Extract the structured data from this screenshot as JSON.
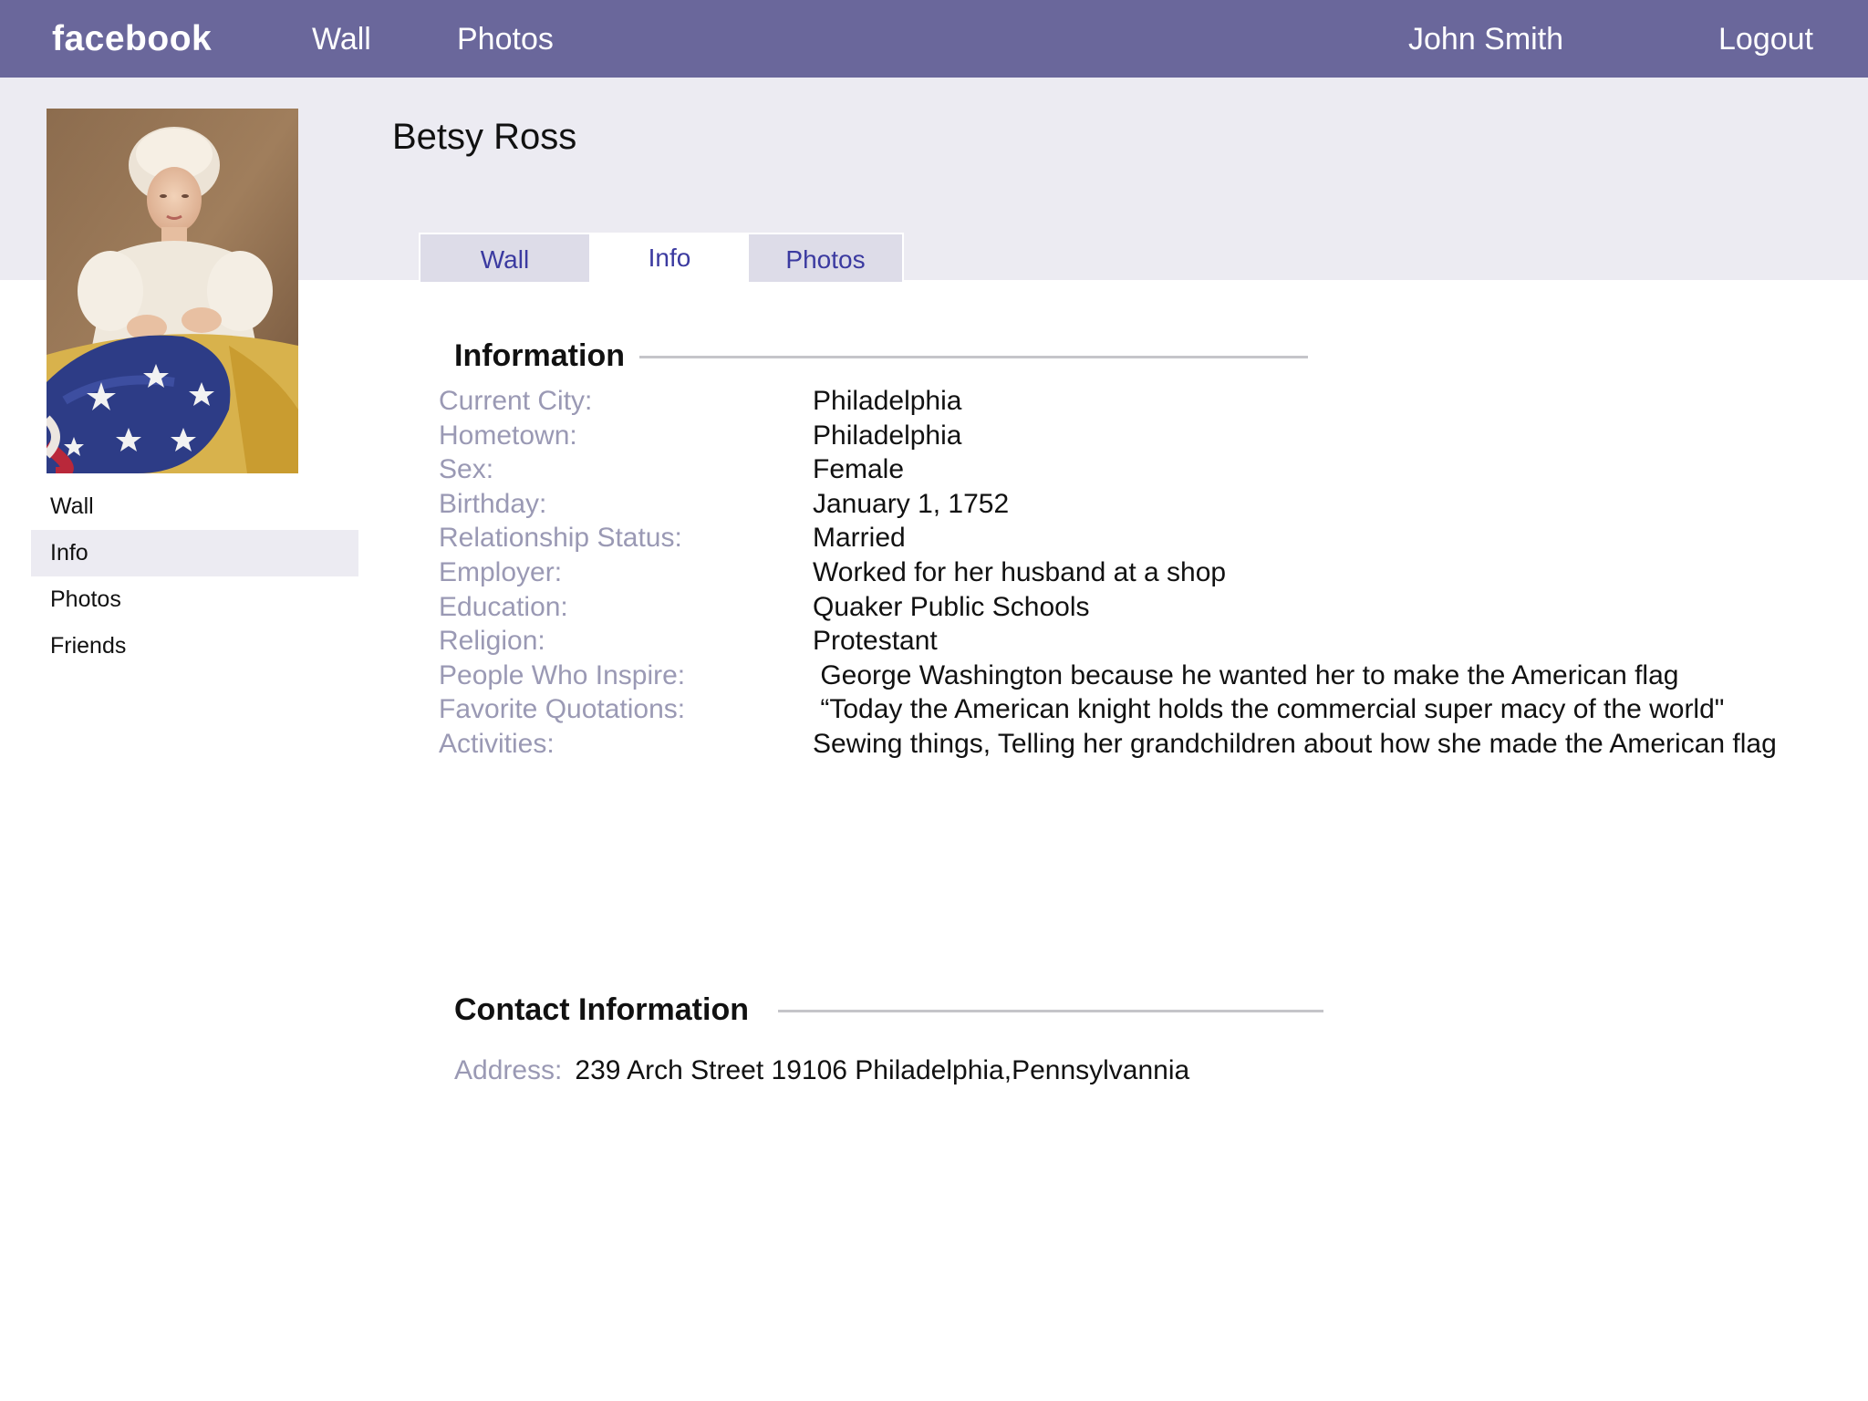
{
  "topbar": {
    "logo": "facebook",
    "nav_wall": "Wall",
    "nav_photos": "Photos",
    "user_name": "John Smith",
    "logout": "Logout"
  },
  "profile": {
    "name": "Betsy Ross",
    "photo_icon": "profile-photo"
  },
  "sidebar": {
    "items": [
      {
        "label": "Wall"
      },
      {
        "label": "Info"
      },
      {
        "label": "Photos"
      },
      {
        "label": "Friends"
      }
    ],
    "active": "Info"
  },
  "tabs": [
    {
      "label": "Wall"
    },
    {
      "label": "Info"
    },
    {
      "label": "Photos"
    }
  ],
  "active_tab": "Info",
  "info": {
    "heading": "Information",
    "rows": [
      {
        "label": "Current City:",
        "value": "Philadelphia"
      },
      {
        "label": "Hometown:",
        "value": "Philadelphia"
      },
      {
        "label": "Sex:",
        "value": "Female"
      },
      {
        "label": "Birthday:",
        "value": "January 1, 1752"
      },
      {
        "label": "Relationship Status:",
        "value": "Married"
      },
      {
        "label": "Employer:",
        "value": "Worked for her husband at a shop"
      },
      {
        "label": "Education:",
        "value": "Quaker Public Schools"
      },
      {
        "label": "Religion:",
        "value": "Protestant"
      },
      {
        "label": "People Who Inspire:",
        "value": " George Washington because he wanted her to make the American flag"
      },
      {
        "label": "Favorite Quotations:",
        "value": " “Today the American knight holds the commercial super macy of the world\""
      },
      {
        "label": "Activities:",
        "value": "Sewing things, Telling her grandchildren about how she made the American flag"
      }
    ]
  },
  "contact": {
    "heading": "Contact Information",
    "address_label": "Address:",
    "address_value": "239 Arch Street 19106 Philadelphia,Pennsylvannia"
  },
  "colors": {
    "topbar": "#6a679b",
    "band": "#ecebf2",
    "label": "#9a99b4",
    "tab_text": "#3b3aa0"
  }
}
